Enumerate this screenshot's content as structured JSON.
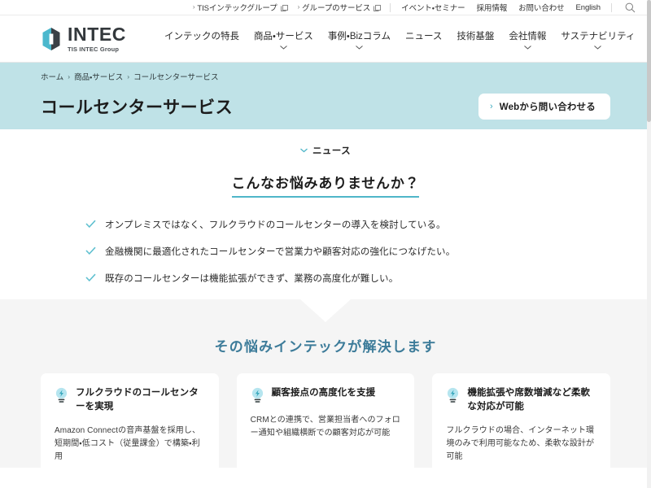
{
  "utility_bar": {
    "links": [
      {
        "label": "TISインテックグループ",
        "chevron": "›",
        "external": true,
        "name": "tis-intec-group-link"
      },
      {
        "label": "グループのサービス",
        "chevron": "›",
        "external": true,
        "name": "group-services-link"
      },
      {
        "label": "イベント・セミナー",
        "chevron": "",
        "external": false,
        "name": "events-seminars-link"
      },
      {
        "label": "採用情報",
        "chevron": "",
        "external": false,
        "name": "recruit-link"
      },
      {
        "label": "お問い合わせ",
        "chevron": "",
        "external": false,
        "name": "contact-link"
      },
      {
        "label": "English",
        "chevron": "",
        "external": false,
        "name": "english-link"
      }
    ],
    "search_icon": "search-icon"
  },
  "header": {
    "logo": {
      "word": "INTEC",
      "sub": "TIS INTEC Group",
      "mark_icon": "intec-logo-mark"
    },
    "nav": [
      {
        "label": "インテックの特長",
        "has_dropdown": false,
        "name": "nav-intec-features"
      },
      {
        "label": "商品・サービス",
        "has_dropdown": true,
        "name": "nav-products-services"
      },
      {
        "label": "事例・Bizコラム",
        "has_dropdown": true,
        "name": "nav-cases-bizcolumn"
      },
      {
        "label": "ニュース",
        "has_dropdown": false,
        "name": "nav-news"
      },
      {
        "label": "技術基盤",
        "has_dropdown": false,
        "name": "nav-technology"
      },
      {
        "label": "会社情報",
        "has_dropdown": true,
        "name": "nav-company"
      },
      {
        "label": "サステナビリティ",
        "has_dropdown": true,
        "name": "nav-sustainability"
      }
    ]
  },
  "hero": {
    "background_color": "#bfe2e7",
    "breadcrumb": [
      {
        "label": "ホーム",
        "name": "breadcrumb-home"
      },
      {
        "label": "商品・サービス",
        "name": "breadcrumb-products-services"
      },
      {
        "label": "コールセンターサービス",
        "name": "breadcrumb-current"
      }
    ],
    "breadcrumb_separator": "›",
    "page_title": "コールセンターサービス",
    "contact_button": {
      "chevron": "›",
      "label": "Webから問い合わせる"
    }
  },
  "news_anchor": {
    "label": "ニュース",
    "icon": "chevron-down-icon"
  },
  "problem_section": {
    "heading": "こんなお悩みありませんか？",
    "underline_color": "#4fb6c9",
    "items": [
      "オンプレミスではなく、フルクラウドのコールセンターの導入を検討している。",
      "金融機関に最適化されたコールセンターで営業力や顧客対応の強化につなげたい。",
      "既存のコールセンターは機能拡張ができず、業務の高度化が難しい。"
    ]
  },
  "solution_section": {
    "heading": "その悩みインテックが解決します",
    "heading_color": "#3c7b99",
    "background_color": "#f5f5f5",
    "cards": [
      {
        "icon": "lightbulb-icon",
        "title": "フルクラウドのコールセンターを実現",
        "body": "Amazon Connectの音声基盤を採用し、短期間・低コスト（従量課金）で構築・利用"
      },
      {
        "icon": "lightbulb-icon",
        "title": "顧客接点の高度化を支援",
        "body": "CRMとの連携で、営業担当者へのフォロー通知や組織横断での顧客対応が可能"
      },
      {
        "icon": "lightbulb-icon",
        "title": "機能拡張や席数増減など柔軟な対応が可能",
        "body": "フルクラウドの場合、インターネット環境のみで利用可能なため、柔軟な設計が可能"
      }
    ]
  },
  "theme": {
    "accent_teal": "#4fb6c9",
    "hero_teal": "#bfe2e7",
    "text_dark": "#1c1c1c"
  }
}
